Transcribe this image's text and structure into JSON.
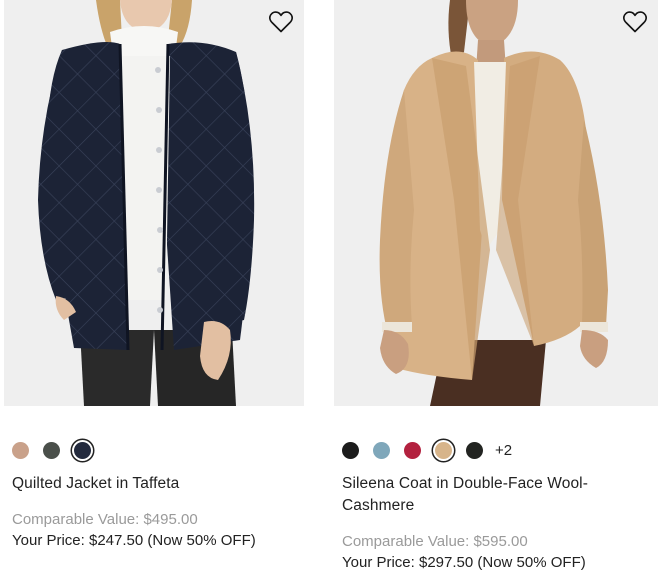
{
  "products": [
    {
      "name": "Quilted Jacket in Taffeta",
      "comparable_value": "Comparable Value: $495.00",
      "your_price": "Your Price: $247.50 (Now 50% OFF)",
      "swatches": [
        {
          "color": "#c9a18a",
          "selected": false
        },
        {
          "color": "#4a4f4a",
          "selected": false
        },
        {
          "color": "#232a3d",
          "selected": true
        }
      ],
      "more_colors": "",
      "wishlist_icon": "heart-outline-icon"
    },
    {
      "name": "Sileena Coat in Double-Face Wool-Cashmere",
      "comparable_value": "Comparable Value: $595.00",
      "your_price": "Your Price: $297.50 (Now 50% OFF)",
      "swatches": [
        {
          "color": "#1c1c1c",
          "selected": false
        },
        {
          "color": "#7fa7ba",
          "selected": false
        },
        {
          "color": "#b3213f",
          "selected": false
        },
        {
          "color": "#d7b48a",
          "selected": true
        },
        {
          "color": "#222421",
          "selected": false
        }
      ],
      "more_colors": "+2",
      "wishlist_icon": "heart-outline-icon"
    }
  ]
}
